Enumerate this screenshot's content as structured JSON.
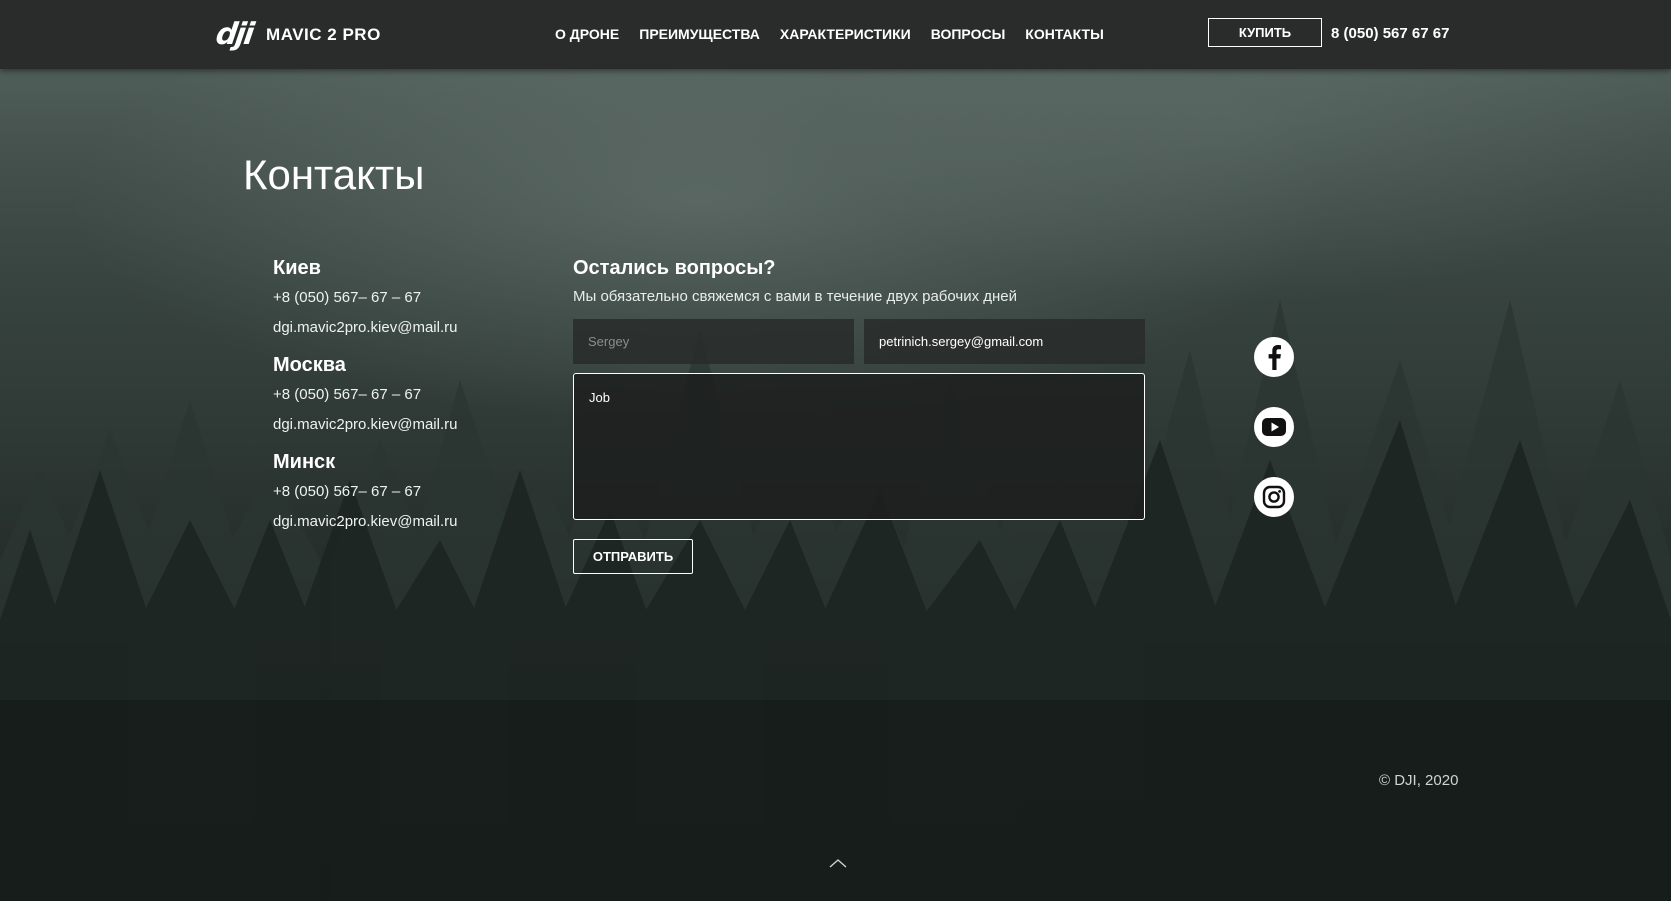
{
  "header": {
    "logo_mark": "dji",
    "logo_text": "MAVIC 2 PRO",
    "nav": [
      "О ДРОНЕ",
      "ПРЕИМУЩЕСТВА",
      "ХАРАКТЕРИСТИКИ",
      "ВОПРОСЫ",
      "КОНТАКТЫ"
    ],
    "buy_label": "КУПИТЬ",
    "phone": "8 (050) 567 67 67"
  },
  "page_title": "Контакты",
  "contacts": [
    {
      "city": "Киев",
      "phone": "+8 (050) 567– 67 – 67",
      "email": "dgi.mavic2pro.kiev@mail.ru"
    },
    {
      "city": "Москва",
      "phone": "+8 (050) 567– 67 – 67",
      "email": "dgi.mavic2pro.kiev@mail.ru"
    },
    {
      "city": "Минск",
      "phone": "+8 (050) 567– 67 – 67",
      "email": "dgi.mavic2pro.kiev@mail.ru"
    }
  ],
  "form": {
    "title": "Остались вопросы?",
    "subtitle": "Мы обязательно свяжемся с вами в течение двух рабочих дней",
    "name_placeholder": "Sergey",
    "name_value": "",
    "email_value": "petrinich.sergey@gmail.com",
    "message_value": "Job",
    "submit_label": "ОТПРАВИТЬ"
  },
  "socials": [
    "facebook-icon",
    "youtube-icon",
    "instagram-icon"
  ],
  "footer": {
    "copyright": "© DJI, 2020"
  },
  "colors": {
    "header_bg": "#2a2c2b",
    "text": "#ffffff",
    "field_bg": "#282c2a"
  }
}
